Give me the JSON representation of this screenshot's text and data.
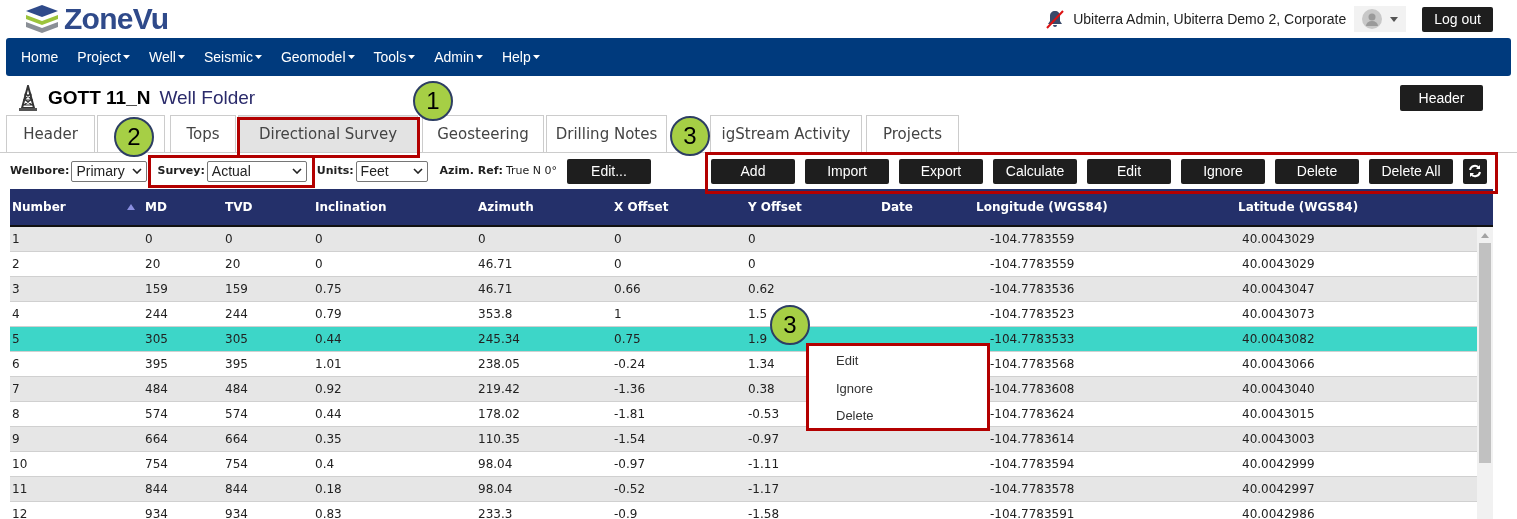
{
  "header": {
    "logo_text": "ZoneVu",
    "user": "Ubiterra Admin, Ubiterra Demo 2, Corporate",
    "logout": "Log out"
  },
  "nav": [
    {
      "label": "Home",
      "dropdown": false
    },
    {
      "label": "Project",
      "dropdown": true
    },
    {
      "label": "Well",
      "dropdown": true
    },
    {
      "label": "Seismic",
      "dropdown": true
    },
    {
      "label": "Geomodel",
      "dropdown": true
    },
    {
      "label": "Tools",
      "dropdown": true
    },
    {
      "label": "Admin",
      "dropdown": true
    },
    {
      "label": "Help",
      "dropdown": true
    }
  ],
  "page": {
    "title": "GOTT 11_N",
    "subtitle": "Well Folder",
    "header_button": "Header"
  },
  "tabs": [
    {
      "label": "Header",
      "selected": false
    },
    {
      "selected": false
    },
    {
      "label": "Tops",
      "selected": false
    },
    {
      "label": "Directional Survey",
      "selected": true
    },
    {
      "label": "Geosteering",
      "selected": false
    },
    {
      "label": "Drilling Notes",
      "selected": false
    },
    {
      "label": "igStream Activity",
      "selected": false
    },
    {
      "label": "Projects",
      "selected": false
    }
  ],
  "filters": {
    "wellbore": {
      "label": "Wellbore:",
      "value": "Primary"
    },
    "survey": {
      "label": "Survey:",
      "value": "Actual"
    },
    "units": {
      "label": "Units:",
      "value": "Feet"
    },
    "azim_ref": {
      "label": "Azim. Ref:",
      "value": "True N 0°"
    },
    "edit_button": "Edit..."
  },
  "toolbar": [
    "Add",
    "Import",
    "Export",
    "Calculate",
    "Edit",
    "Ignore",
    "Delete",
    "Delete All"
  ],
  "table": {
    "columns": [
      {
        "label": "Number",
        "sorted": true
      },
      {
        "label": "MD",
        "sorted": false
      },
      {
        "label": "TVD",
        "sorted": false
      },
      {
        "label": "Inclination",
        "sorted": false
      },
      {
        "label": "Azimuth",
        "sorted": false
      },
      {
        "label": "X Offset",
        "sorted": false
      },
      {
        "label": "Y Offset",
        "sorted": false
      },
      {
        "label": "Date",
        "sorted": false
      },
      {
        "label": "Longitude (WGS84)",
        "sorted": false
      },
      {
        "label": "Latitude (WGS84)",
        "sorted": false
      }
    ],
    "rows": [
      {
        "cells": [
          "1",
          "0",
          "0",
          "0",
          "0",
          "0",
          "0",
          "",
          "-104.7783559",
          "40.0043029"
        ],
        "selected": false
      },
      {
        "cells": [
          "2",
          "20",
          "20",
          "0",
          "46.71",
          "0",
          "0",
          "",
          "-104.7783559",
          "40.0043029"
        ],
        "selected": false
      },
      {
        "cells": [
          "3",
          "159",
          "159",
          "0.75",
          "46.71",
          "0.66",
          "0.62",
          "",
          "-104.7783536",
          "40.0043047"
        ],
        "selected": false
      },
      {
        "cells": [
          "4",
          "244",
          "244",
          "0.79",
          "353.8",
          "1",
          "1.5",
          "",
          "-104.7783523",
          "40.0043073"
        ],
        "selected": false
      },
      {
        "cells": [
          "5",
          "305",
          "305",
          "0.44",
          "245.34",
          "0.75",
          "1.9",
          "",
          "-104.7783533",
          "40.0043082"
        ],
        "selected": true
      },
      {
        "cells": [
          "6",
          "395",
          "395",
          "1.01",
          "238.05",
          "-0.24",
          "1.34",
          "",
          "-104.7783568",
          "40.0043066"
        ],
        "selected": false
      },
      {
        "cells": [
          "7",
          "484",
          "484",
          "0.92",
          "219.42",
          "-1.36",
          "0.38",
          "",
          "-104.7783608",
          "40.0043040"
        ],
        "selected": false
      },
      {
        "cells": [
          "8",
          "574",
          "574",
          "0.44",
          "178.02",
          "-1.81",
          "-0.53",
          "",
          "-104.7783624",
          "40.0043015"
        ],
        "selected": false
      },
      {
        "cells": [
          "9",
          "664",
          "664",
          "0.35",
          "110.35",
          "-1.54",
          "-0.97",
          "",
          "-104.7783614",
          "40.0043003"
        ],
        "selected": false
      },
      {
        "cells": [
          "10",
          "754",
          "754",
          "0.4",
          "98.04",
          "-0.97",
          "-1.11",
          "",
          "-104.7783594",
          "40.0042999"
        ],
        "selected": false
      },
      {
        "cells": [
          "11",
          "844",
          "844",
          "0.18",
          "98.04",
          "-0.52",
          "-1.17",
          "",
          "-104.7783578",
          "40.0042997"
        ],
        "selected": false
      },
      {
        "cells": [
          "12",
          "934",
          "934",
          "0.83",
          "233.3",
          "-0.9",
          "-1.58",
          "",
          "-104.7783591",
          "40.0042986"
        ],
        "selected": false
      }
    ]
  },
  "context_menu": [
    "Edit",
    "Ignore",
    "Delete"
  ],
  "callouts": [
    "1",
    "2",
    "3",
    "3"
  ]
}
